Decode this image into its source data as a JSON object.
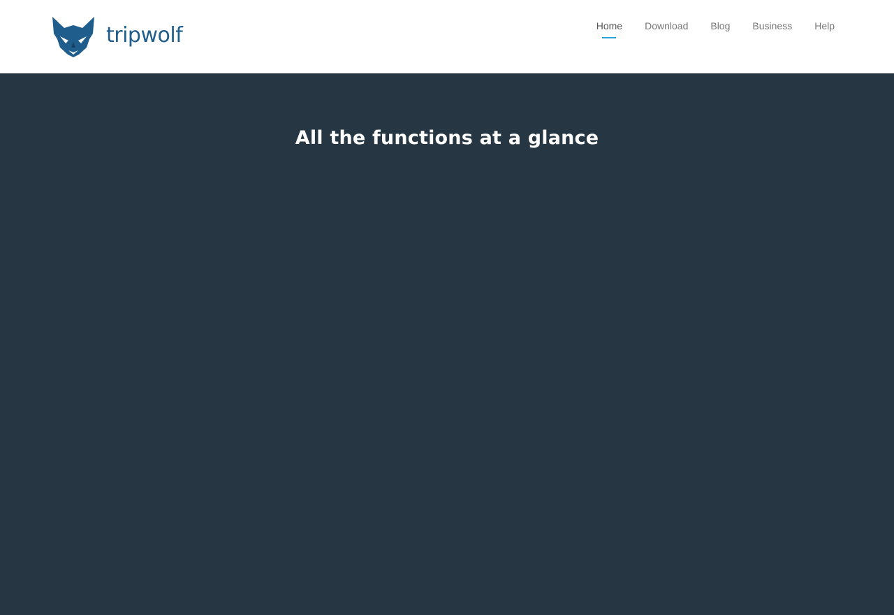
{
  "brand": {
    "name": "tripwolf",
    "logo_icon": "wolf-head-icon",
    "color": "#1f5d8c"
  },
  "nav": {
    "items": [
      {
        "label": "Home",
        "active": true
      },
      {
        "label": "Download",
        "active": false
      },
      {
        "label": "Blog",
        "active": false
      },
      {
        "label": "Business",
        "active": false
      },
      {
        "label": "Help",
        "active": false
      }
    ],
    "active_underline_color": "#2b9fd6"
  },
  "main": {
    "title": "All the functions at a glance",
    "background": "#263642"
  }
}
